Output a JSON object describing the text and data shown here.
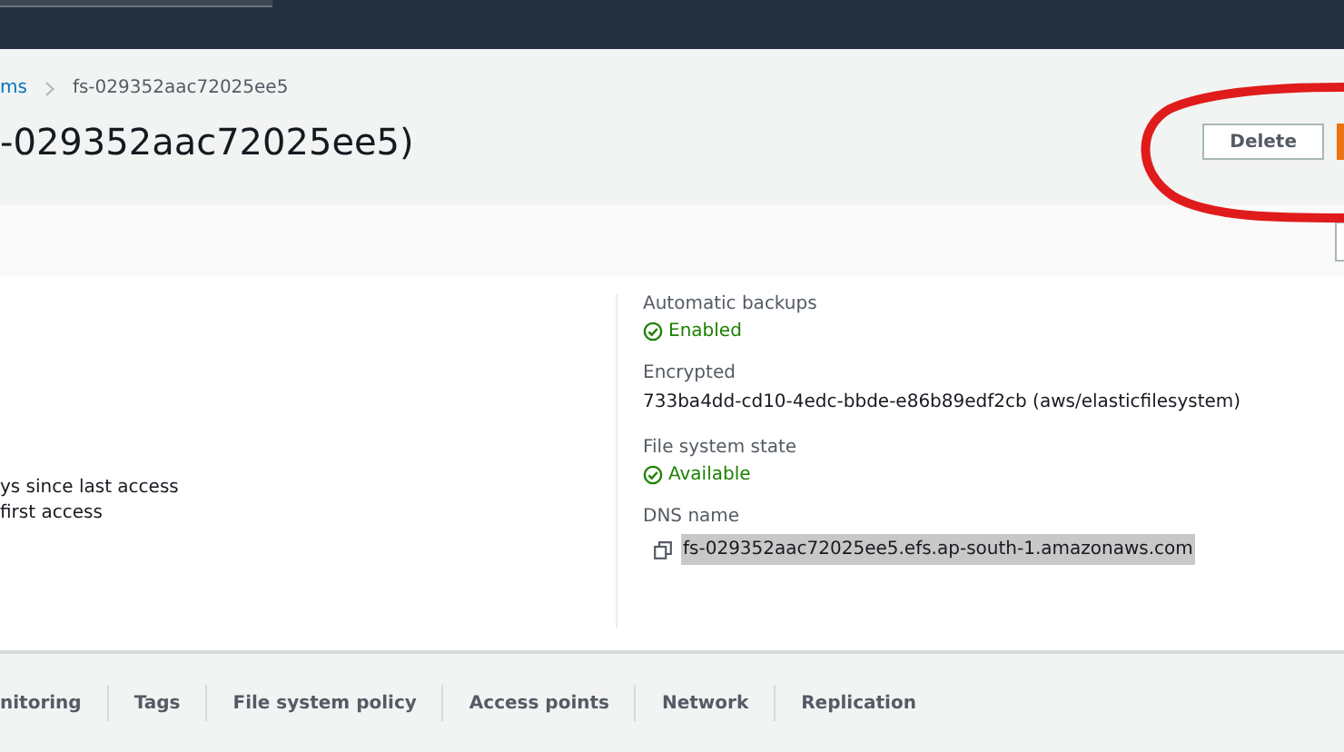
{
  "breadcrumb": [
    {
      "label": "ms",
      "link": true
    },
    {
      "label": "fs-029352aac72025ee5",
      "link": false
    }
  ],
  "title": "-029352aac72025ee5)",
  "actions": [
    {
      "label": "Delete",
      "kind": "normal"
    },
    {
      "kind": "primary"
    }
  ],
  "left_details": [
    "ys since last access",
    "first access"
  ],
  "details": [
    {
      "label": "Automatic backups",
      "value": "Enabled",
      "kind": "status"
    },
    {
      "label": "Encrypted",
      "value": "733ba4dd-cd10-4edc-bbde-e86b89edf2cb (aws/elasticfilesystem)",
      "kind": "text"
    },
    {
      "label": "File system state",
      "value": "Available",
      "kind": "status"
    },
    {
      "label": "DNS name",
      "value": "fs-029352aac72025ee5.efs.ap-south-1.amazonaws.com",
      "kind": "copy"
    }
  ],
  "tabs": [
    "nitoring",
    "Tags",
    "File system policy",
    "Access points",
    "Network",
    "Replication"
  ]
}
